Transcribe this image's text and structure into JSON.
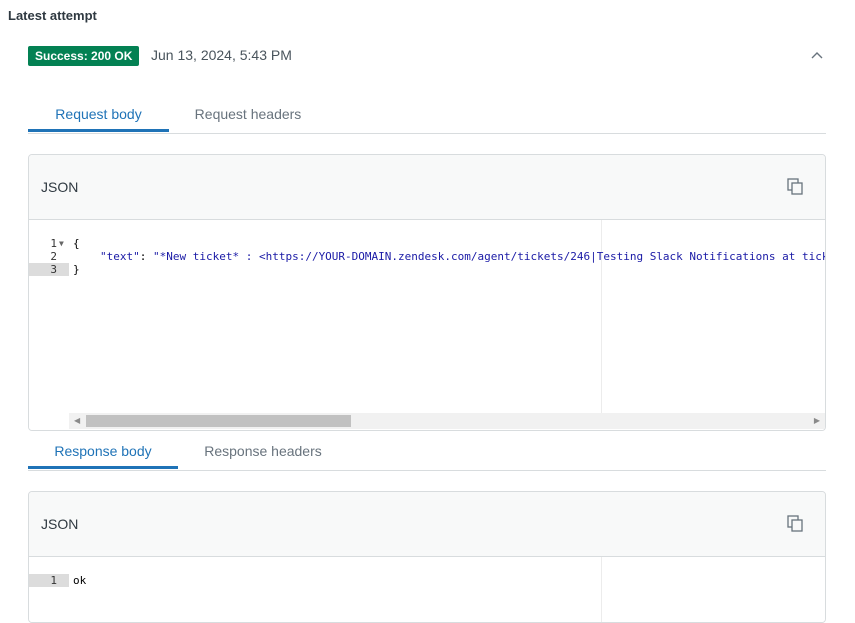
{
  "section": {
    "title": "Latest attempt"
  },
  "attempt": {
    "status_badge": "Success: 200 OK",
    "timestamp": "Jun 13, 2024, 5:43 PM",
    "collapse_icon": "chevron-up-icon",
    "status_color": "#038153"
  },
  "request_tabs": [
    {
      "label": "Request body",
      "active": true
    },
    {
      "label": "Request headers",
      "active": false
    }
  ],
  "request_panel": {
    "label": "JSON",
    "copy_icon": "copy-icon",
    "lines": [
      {
        "num": "1",
        "text": "{"
      },
      {
        "num": "2",
        "key": "\"text\"",
        "sep": ": ",
        "value": "\"*New ticket* : <https://YOUR-DOMAIN.zendesk.com/agent/tickets/246|Testing Slack Notifications at tick"
      },
      {
        "num": "3",
        "text": "}"
      }
    ]
  },
  "response_tabs": [
    {
      "label": "Response body",
      "active": true
    },
    {
      "label": "Response headers",
      "active": false
    }
  ],
  "response_panel": {
    "label": "JSON",
    "copy_icon": "copy-icon",
    "lines": [
      {
        "num": "1",
        "text": "ok"
      }
    ]
  },
  "colors": {
    "accent": "#1f73b7",
    "border": "#d8dcde"
  }
}
